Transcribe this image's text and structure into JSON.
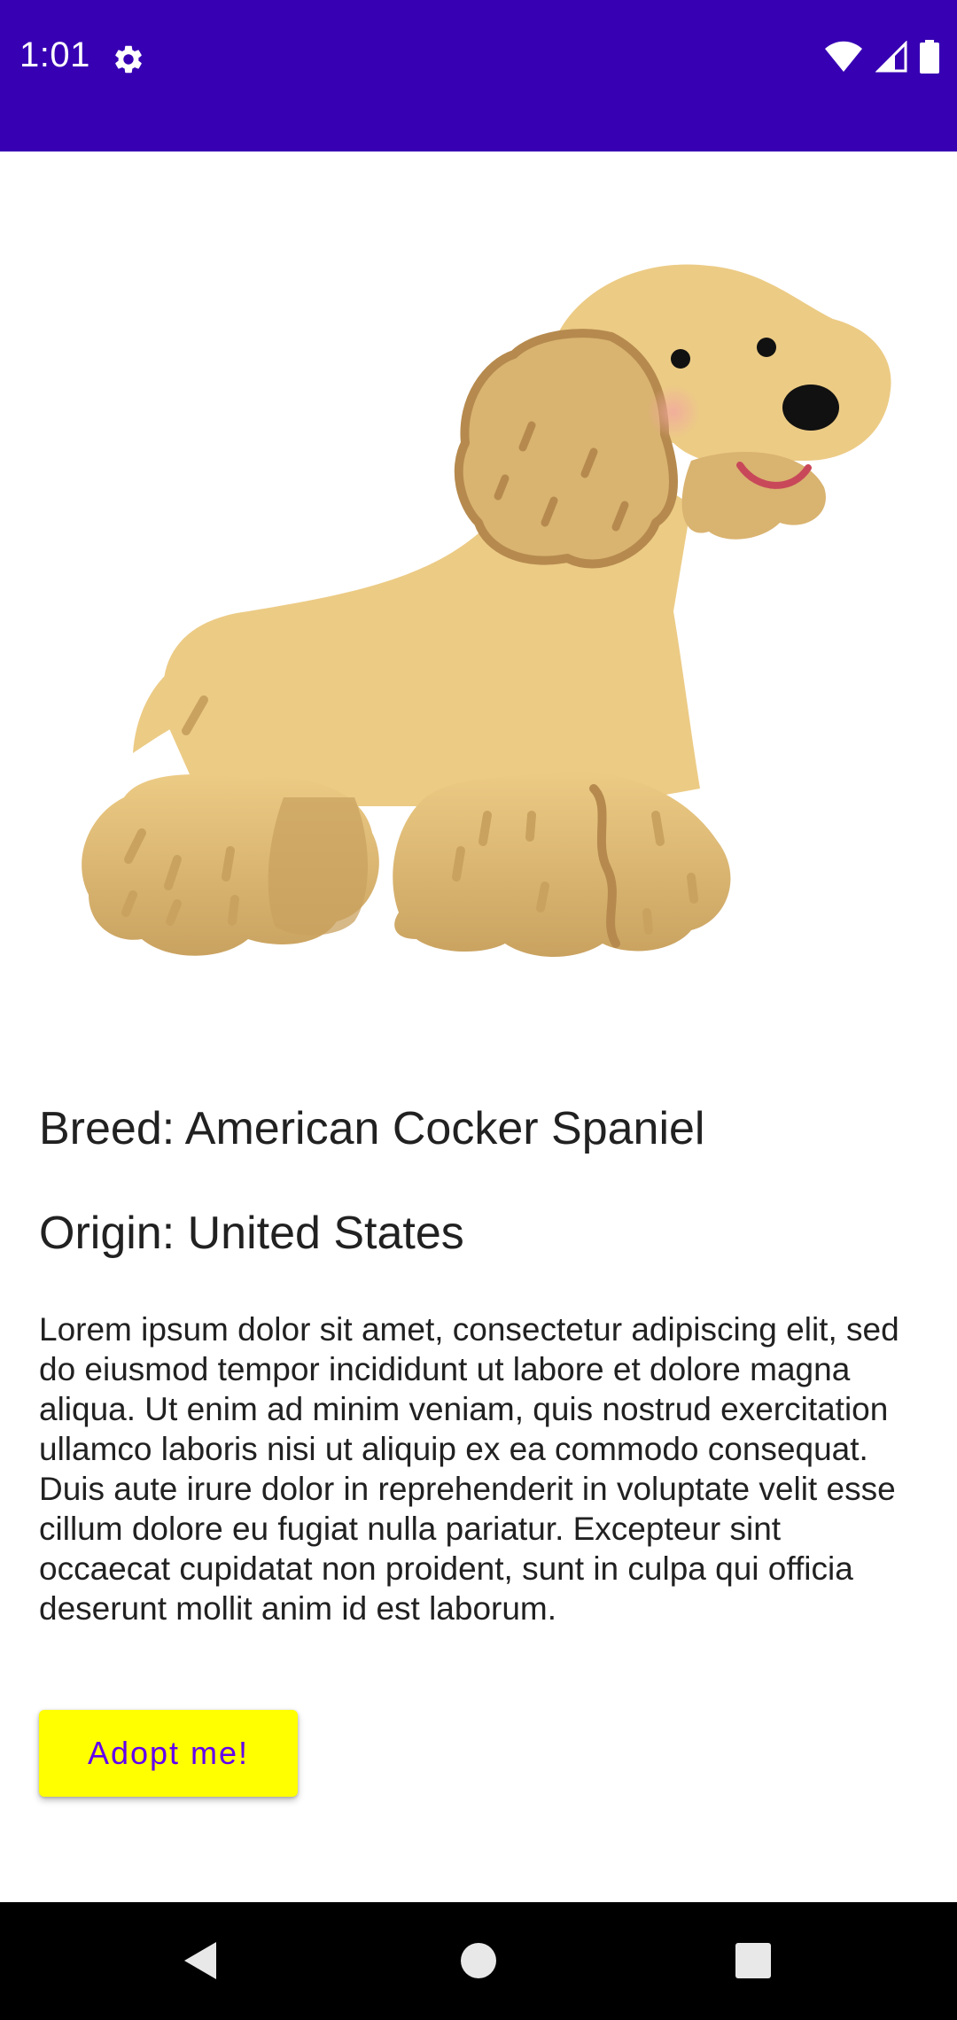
{
  "status_bar": {
    "time": "1:01",
    "background": "#3700b3",
    "icons": [
      "settings-icon",
      "wifi-icon",
      "signal-icon",
      "battery-icon"
    ]
  },
  "dog": {
    "image_icon": "cocker-spaniel-illustration",
    "breed": "Breed: American Cocker Spaniel",
    "origin": "Origin: United States",
    "description": "Lorem ipsum dolor sit amet, consectetur adipiscing elit, sed do eiusmod tempor incididunt ut labore et dolore magna aliqua. Ut enim ad minim veniam, quis nostrud exercitation ullamco laboris nisi ut aliquip ex ea commodo consequat. Duis aute irure dolor in reprehenderit in voluptate velit esse cillum dolore eu fugiat nulla pariatur. Excepteur sint occaecat cupidatat non proident, sunt in culpa qui officia deserunt mollit anim id est laborum."
  },
  "actions": {
    "adopt_label": "Adopt me!",
    "adopt_bg": "#ffff00",
    "adopt_text_color": "#6200ee"
  },
  "nav_bar": {
    "icons": [
      "back-icon",
      "home-icon",
      "recents-icon"
    ]
  }
}
